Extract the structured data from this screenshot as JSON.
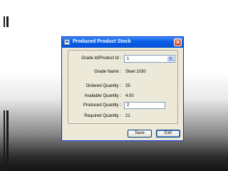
{
  "window": {
    "title": "Produced Product Stock",
    "close_glyph": "×"
  },
  "form": {
    "grade_id_label": "Grade Id/Product Id :",
    "grade_id_value": "1",
    "grade_name_label": "Grade Name :",
    "grade_name_value": "Steel 1030",
    "ordered_qty_label": "Ordered Quantity :",
    "ordered_qty_value": "25",
    "available_qty_label": "Available Quantity :",
    "available_qty_value": "4.00",
    "produced_qty_label": "Produced Quantity :",
    "produced_qty_value": "2",
    "required_qty_label": "Required Quantity :",
    "required_qty_value": "21"
  },
  "buttons": {
    "save_label": "Save",
    "exit_label": "Exit"
  },
  "icons": {
    "app": "form-window-icon",
    "close": "close-icon",
    "dropdown": "chevron-down-icon"
  },
  "colors": {
    "titlebar": "#0a5ee8",
    "window_bg": "#ece9d8"
  }
}
